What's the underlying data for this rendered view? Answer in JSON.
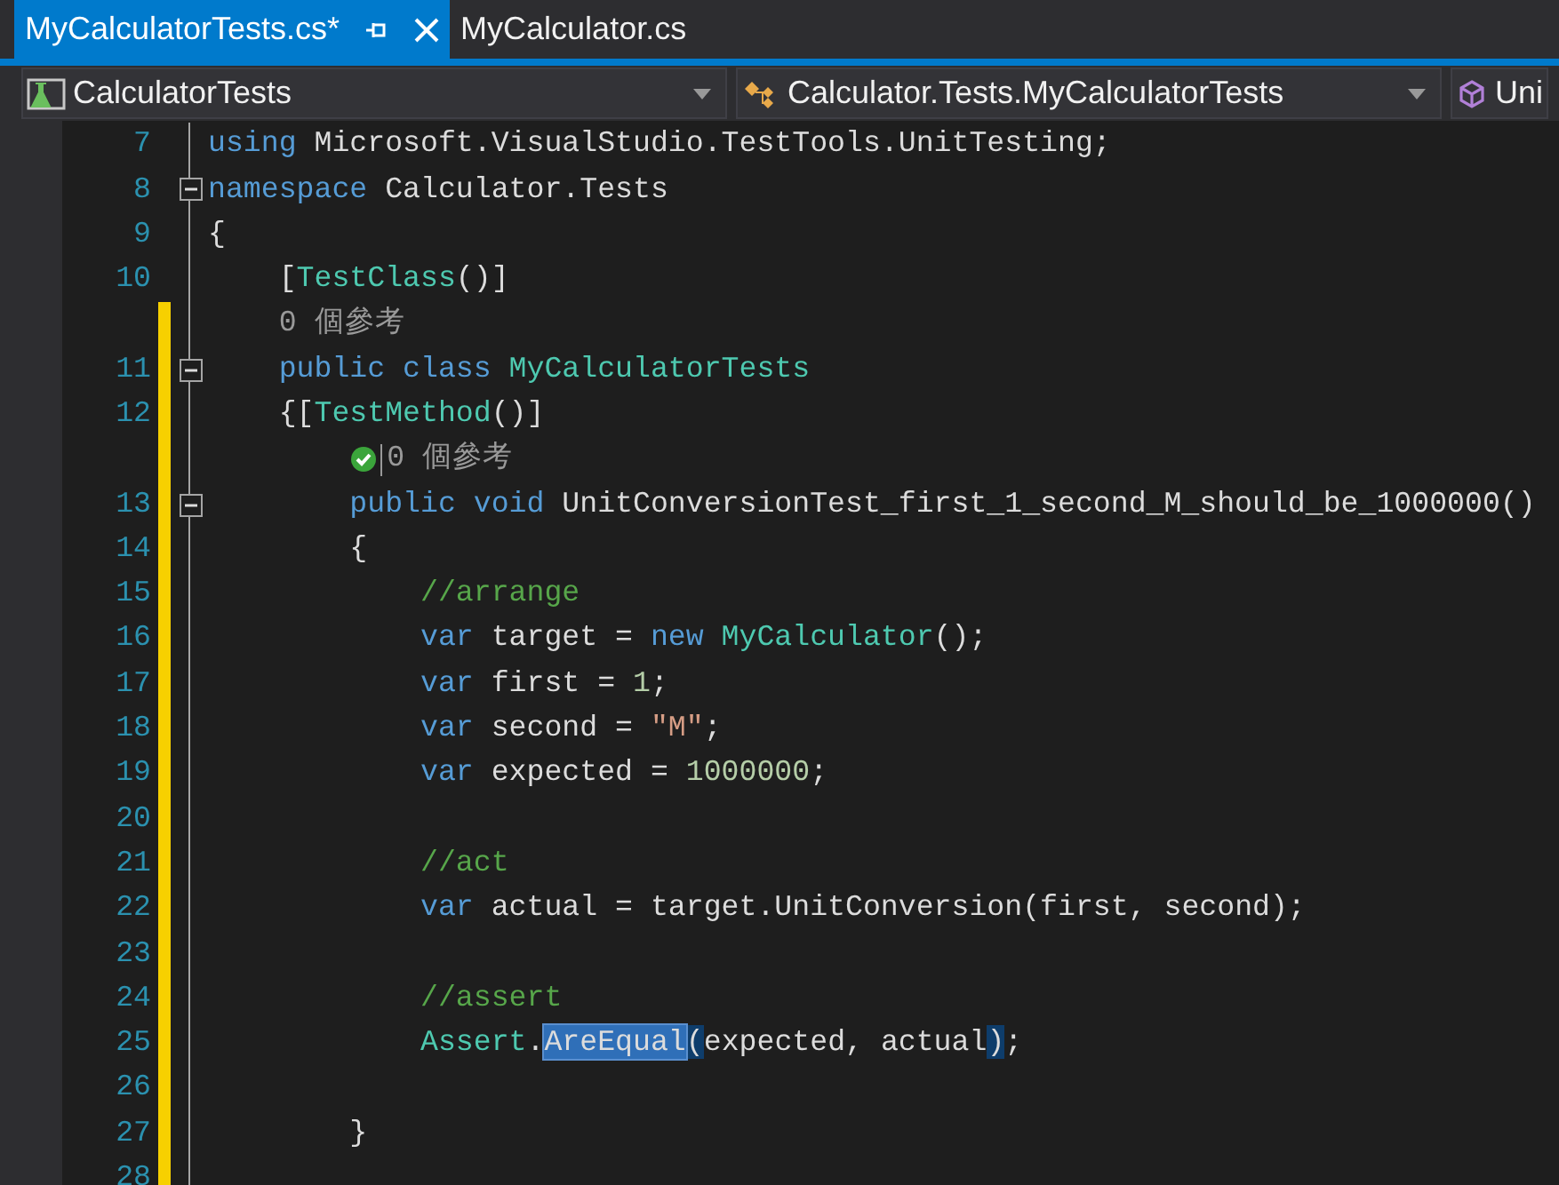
{
  "tabs": [
    {
      "label": "MyCalculatorTests.cs*",
      "selected": true
    },
    {
      "label": "MyCalculator.cs",
      "selected": false
    }
  ],
  "navigation_bar": [
    {
      "label": "CalculatorTests",
      "kind": "project"
    },
    {
      "label": "Calculator.Tests.MyCalculatorTests",
      "kind": "class"
    },
    {
      "label": "Uni",
      "kind": "member"
    }
  ],
  "editor": {
    "lines": [
      {
        "number": "7",
        "changed": false,
        "foldable": false,
        "tokens": [
          {
            "kind": "keyword",
            "text": "using"
          },
          {
            "kind": "plain",
            "text": " Microsoft.VisualStudio.TestTools.UnitTesting;"
          }
        ]
      },
      {
        "number": "8",
        "changed": false,
        "foldable": true,
        "tokens": [
          {
            "kind": "keyword",
            "text": "namespace"
          },
          {
            "kind": "plain",
            "text": " Calculator.Tests"
          }
        ]
      },
      {
        "number": "9",
        "changed": false,
        "foldable": false,
        "tokens": [
          {
            "kind": "plain",
            "text": "{"
          }
        ]
      },
      {
        "number": "10",
        "changed": false,
        "foldable": false,
        "tokens": [
          {
            "kind": "plain",
            "text": "    ["
          },
          {
            "kind": "type",
            "text": "TestClass"
          },
          {
            "kind": "plain",
            "text": "()]"
          }
        ]
      },
      {
        "number": "11",
        "changed": true,
        "foldable": true,
        "codelens": {
          "text": "0 個參考",
          "passed": false
        },
        "tokens": [
          {
            "kind": "keyword",
            "text": "    public class"
          },
          {
            "kind": "type",
            "text": " MyCalculatorTests"
          }
        ]
      },
      {
        "number": "12",
        "changed": true,
        "foldable": false,
        "tokens": [
          {
            "kind": "plain",
            "text": "    {["
          },
          {
            "kind": "type",
            "text": "TestMethod"
          },
          {
            "kind": "plain",
            "text": "()]"
          }
        ]
      },
      {
        "number": "13",
        "changed": true,
        "foldable": true,
        "codelens": {
          "text": "0 個參考",
          "passed": true
        },
        "tokens": [
          {
            "kind": "keyword",
            "text": "        public void"
          },
          {
            "kind": "plain",
            "text": " UnitConversionTest_first_1_second_M_should_be_1000000()"
          }
        ]
      },
      {
        "number": "14",
        "changed": true,
        "foldable": false,
        "tokens": [
          {
            "kind": "plain",
            "text": "        {"
          }
        ]
      },
      {
        "number": "15",
        "changed": true,
        "foldable": false,
        "tokens": [
          {
            "kind": "comment",
            "text": "            //arrange"
          }
        ]
      },
      {
        "number": "16",
        "changed": true,
        "foldable": false,
        "tokens": [
          {
            "kind": "keyword",
            "text": "            var"
          },
          {
            "kind": "plain",
            "text": " target = "
          },
          {
            "kind": "keyword",
            "text": "new"
          },
          {
            "kind": "type",
            "text": " MyCalculator"
          },
          {
            "kind": "plain",
            "text": "();"
          }
        ]
      },
      {
        "number": "17",
        "changed": true,
        "foldable": false,
        "tokens": [
          {
            "kind": "keyword",
            "text": "            var"
          },
          {
            "kind": "plain",
            "text": " first = "
          },
          {
            "kind": "number",
            "text": "1"
          },
          {
            "kind": "plain",
            "text": ";"
          }
        ]
      },
      {
        "number": "18",
        "changed": true,
        "foldable": false,
        "tokens": [
          {
            "kind": "keyword",
            "text": "            var"
          },
          {
            "kind": "plain",
            "text": " second = "
          },
          {
            "kind": "string",
            "text": "\"M\""
          },
          {
            "kind": "plain",
            "text": ";"
          }
        ]
      },
      {
        "number": "19",
        "changed": true,
        "foldable": false,
        "tokens": [
          {
            "kind": "keyword",
            "text": "            var"
          },
          {
            "kind": "plain",
            "text": " expected = "
          },
          {
            "kind": "number",
            "text": "1000000"
          },
          {
            "kind": "plain",
            "text": ";"
          }
        ]
      },
      {
        "number": "20",
        "changed": true,
        "foldable": false
      },
      {
        "number": "21",
        "changed": true,
        "foldable": false,
        "tokens": [
          {
            "kind": "comment",
            "text": "            //act"
          }
        ]
      },
      {
        "number": "22",
        "changed": true,
        "foldable": false,
        "tokens": [
          {
            "kind": "keyword",
            "text": "            var"
          },
          {
            "kind": "plain",
            "text": " actual = target.UnitConversion(first, second);"
          }
        ]
      },
      {
        "number": "23",
        "changed": true,
        "foldable": false
      },
      {
        "number": "24",
        "changed": true,
        "foldable": false,
        "tokens": [
          {
            "kind": "comment",
            "text": "            //assert"
          }
        ]
      },
      {
        "number": "25",
        "changed": true,
        "foldable": false,
        "tokens": [
          {
            "kind": "type",
            "text": "            Assert"
          },
          {
            "kind": "plain",
            "text": "."
          },
          {
            "kind": "selected",
            "text": "AreEqual"
          },
          {
            "kind": "brace_match",
            "text": "("
          },
          {
            "kind": "plain",
            "text": "expected, actual"
          },
          {
            "kind": "brace_match",
            "text": ")"
          },
          {
            "kind": "plain",
            "text": ";"
          }
        ]
      },
      {
        "number": "26",
        "changed": true,
        "foldable": false
      },
      {
        "number": "27",
        "changed": true,
        "foldable": false,
        "tokens": [
          {
            "kind": "plain",
            "text": "        }"
          }
        ]
      },
      {
        "number": "28",
        "changed": true,
        "foldable": false
      }
    ]
  }
}
